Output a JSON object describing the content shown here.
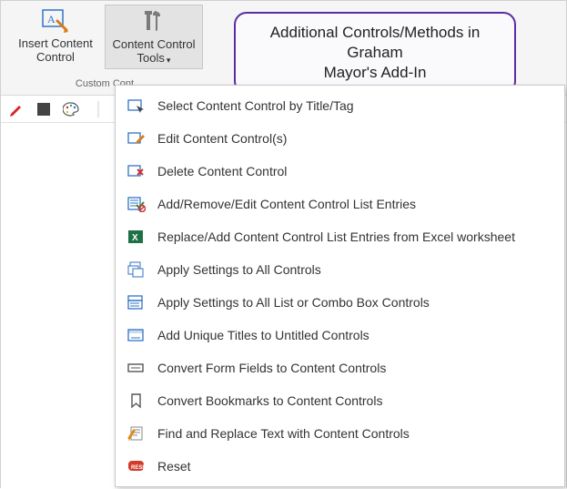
{
  "ribbon": {
    "group_label": "Custom Cont",
    "insert": {
      "label_l1": "Insert Content",
      "label_l2": "Control"
    },
    "tools": {
      "label_l1": "Content Control",
      "label_l2": "Tools"
    }
  },
  "callout": {
    "line1": "Additional Controls/Methods in Graham",
    "line2": "Mayor's Add-In"
  },
  "menu": {
    "items": [
      {
        "icon": "select-cc-icon",
        "label": "Select Content Control by Title/Tag"
      },
      {
        "icon": "edit-cc-icon",
        "label": "Edit Content Control(s)"
      },
      {
        "icon": "delete-cc-icon",
        "label": "Delete Content Control"
      },
      {
        "icon": "list-edit-icon",
        "label": "Add/Remove/Edit Content Control List Entries"
      },
      {
        "icon": "excel-icon",
        "label": "Replace/Add Content Control List Entries from Excel worksheet"
      },
      {
        "icon": "apply-all-icon",
        "label": "Apply Settings to All Controls"
      },
      {
        "icon": "apply-list-icon",
        "label": "Apply Settings to All List or Combo Box Controls"
      },
      {
        "icon": "titles-icon",
        "label": "Add Unique Titles to Untitled Controls"
      },
      {
        "icon": "convert-form-icon",
        "label": "Convert Form Fields to Content Controls"
      },
      {
        "icon": "bookmark-icon",
        "label": "Convert Bookmarks to Content Controls"
      },
      {
        "icon": "find-replace-icon",
        "label": "Find and Replace Text with Content Controls"
      },
      {
        "icon": "reset-icon",
        "label": "Reset"
      }
    ]
  }
}
